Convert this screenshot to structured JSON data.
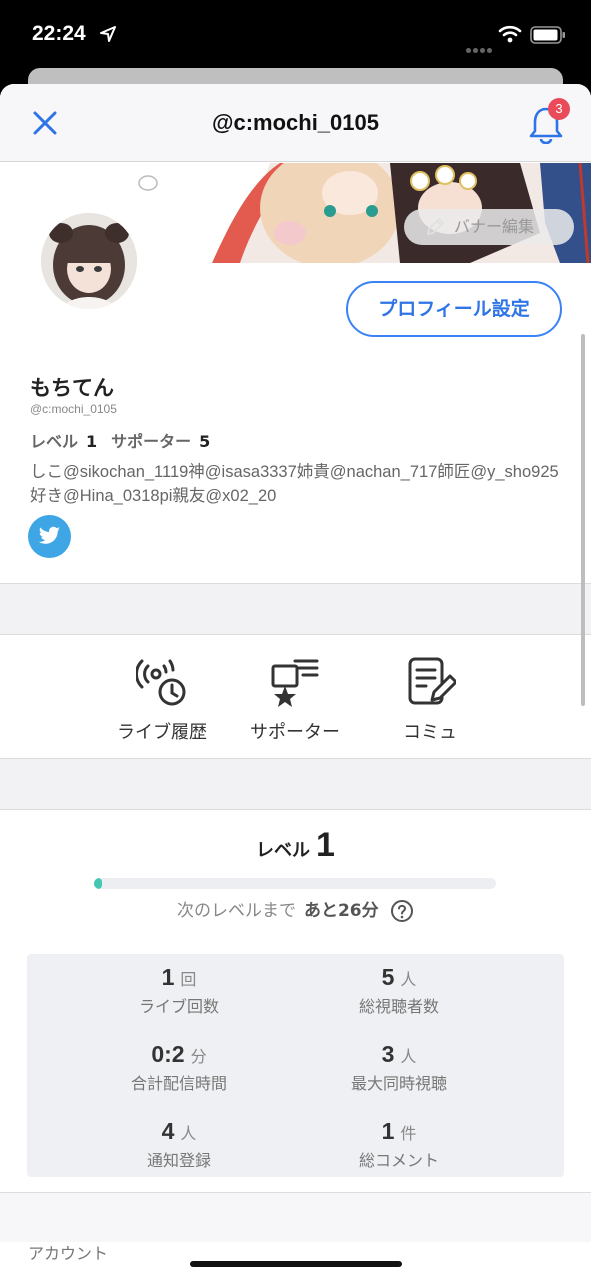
{
  "status_bar": {
    "time": "22:24"
  },
  "nav": {
    "title": "@c:mochi_0105",
    "notification_count": "3"
  },
  "banner": {
    "edit_label": "バナー編集"
  },
  "profile": {
    "settings_button": "プロフィール設定",
    "display_name": "もちてん",
    "handle": "@c:mochi_0105",
    "level_label": "レベル",
    "level_value": "1",
    "supporter_label": "サポーター",
    "supporter_value": "5",
    "bio": "しこ@sikochan_1119神@isasa3337姉貴@nachan_717師匠@y_sho925好き@Hina_0318pi親友@x02_20",
    "social_icon": "twitter-icon"
  },
  "menu": [
    {
      "label": "ライブ履歴",
      "icon": "live-history-icon"
    },
    {
      "label": "サポーター",
      "icon": "supporter-icon"
    },
    {
      "label": "コミュ",
      "icon": "community-icon"
    }
  ],
  "level_section": {
    "label": "レベル",
    "value": "1",
    "progress_fraction": 0.02,
    "next_prefix": "次のレベルまで",
    "next_value": "あと26分"
  },
  "stats": [
    {
      "value": "1",
      "unit": "回",
      "name": "ライブ回数"
    },
    {
      "value": "5",
      "unit": "人",
      "name": "総視聴者数"
    },
    {
      "value": "0:2",
      "unit": "分",
      "name": "合計配信時間"
    },
    {
      "value": "3",
      "unit": "人",
      "name": "最大同時視聴"
    },
    {
      "value": "4",
      "unit": "人",
      "name": "通知登録"
    },
    {
      "value": "1",
      "unit": "件",
      "name": "総コメント"
    }
  ],
  "account": {
    "label": "アカウント"
  },
  "colors": {
    "accent": "#3b82f6",
    "badge": "#e94b5b",
    "progress": "#44c6b4",
    "twitter": "#3fa6e6"
  }
}
